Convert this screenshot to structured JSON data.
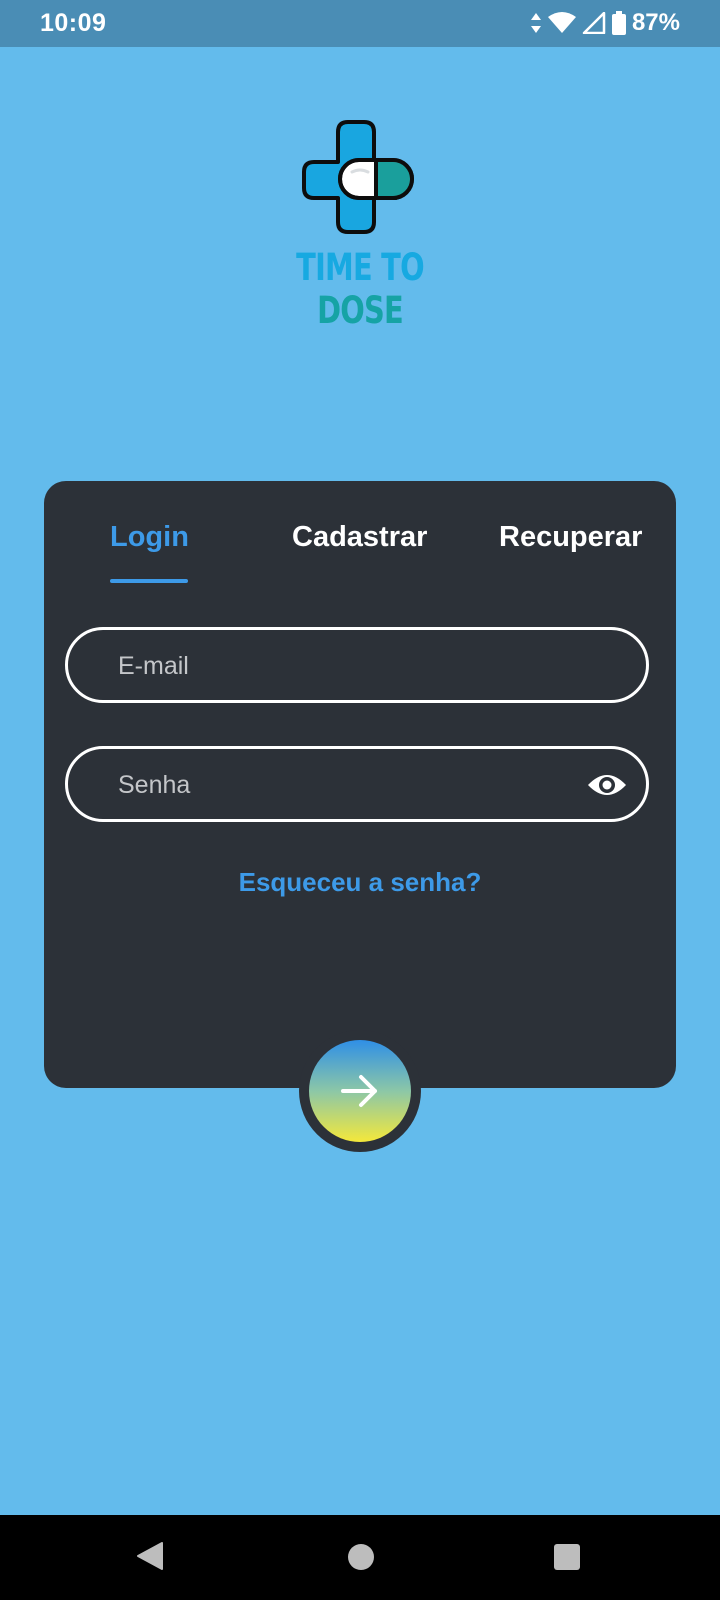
{
  "status_bar": {
    "time": "10:09",
    "battery_percent": "87%",
    "icons": [
      "data-arrows-icon",
      "wifi-icon",
      "signal-icon",
      "battery-icon"
    ]
  },
  "logo": {
    "word1": "TIME TO",
    "word2": "DOSE",
    "colors": {
      "primary": "#17a9e1",
      "secondary": "#16a3a5"
    }
  },
  "auth": {
    "tabs": [
      {
        "label": "Login",
        "active": true
      },
      {
        "label": "Cadastrar",
        "active": false
      },
      {
        "label": "Recuperar",
        "active": false
      }
    ],
    "email": {
      "placeholder": "E-mail",
      "value": ""
    },
    "password": {
      "placeholder": "Senha",
      "value": ""
    },
    "forgot_label": "Esqueceu a senha?",
    "submit_icon": "arrow-right-icon"
  },
  "colors": {
    "background": "#63bbec",
    "card": "#2c3138",
    "accent": "#3d9ae8",
    "status_bar": "#4a8db5"
  },
  "nav_bar": {
    "buttons": [
      "back-icon",
      "home-icon",
      "recents-icon"
    ]
  }
}
